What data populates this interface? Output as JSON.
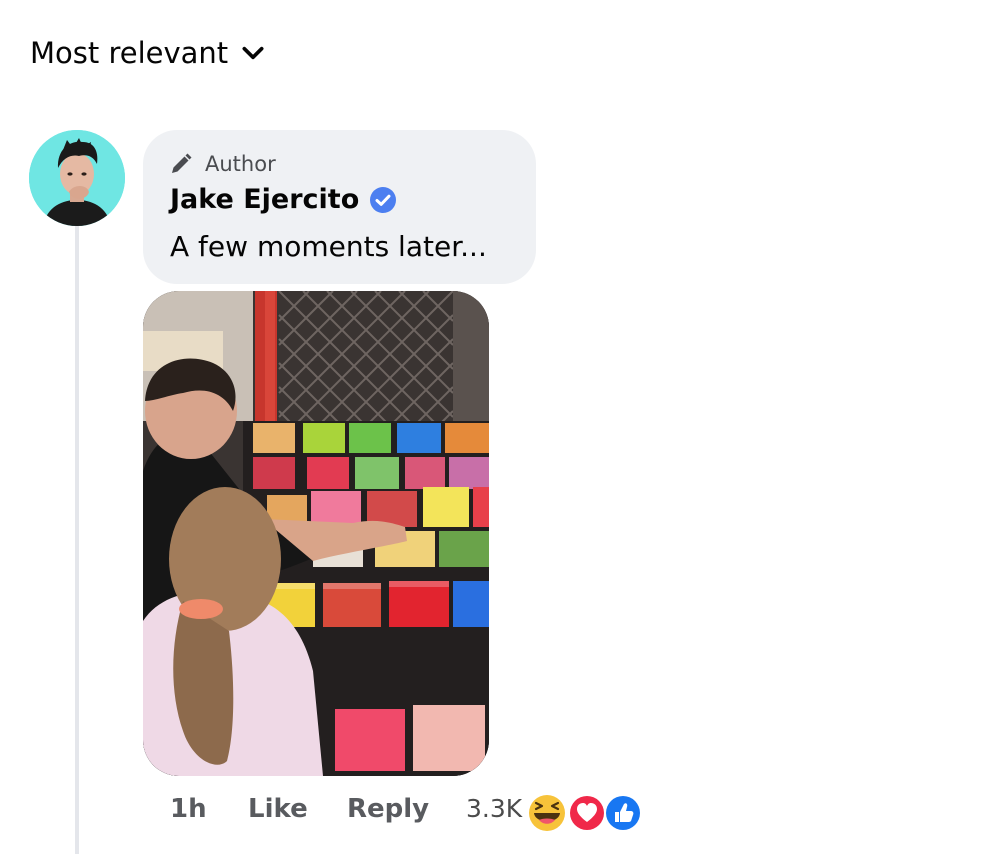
{
  "sort": {
    "label": "Most relevant",
    "icon": "chevron-down-icon"
  },
  "comment": {
    "badge_icon": "pencil-icon",
    "badge_label": "Author",
    "author_name": "Jake Ejercito",
    "verified_icon": "verified-badge-icon",
    "text": "A few moments later...",
    "image_alt": "candy-store-photo",
    "actions": {
      "time": "1h",
      "like": "Like",
      "reply": "Reply"
    },
    "reaction_count": "3.3K",
    "reactions": [
      "haha-reaction-icon",
      "love-reaction-icon",
      "like-reaction-icon"
    ]
  },
  "colors": {
    "verified_blue": "#4c7ff0",
    "bubble_bg": "#eff1f4",
    "avatar_bg": "#6fe6e3",
    "love_red": "#f02849",
    "like_blue": "#1877f2",
    "haha_yellow": "#f7c33a"
  }
}
